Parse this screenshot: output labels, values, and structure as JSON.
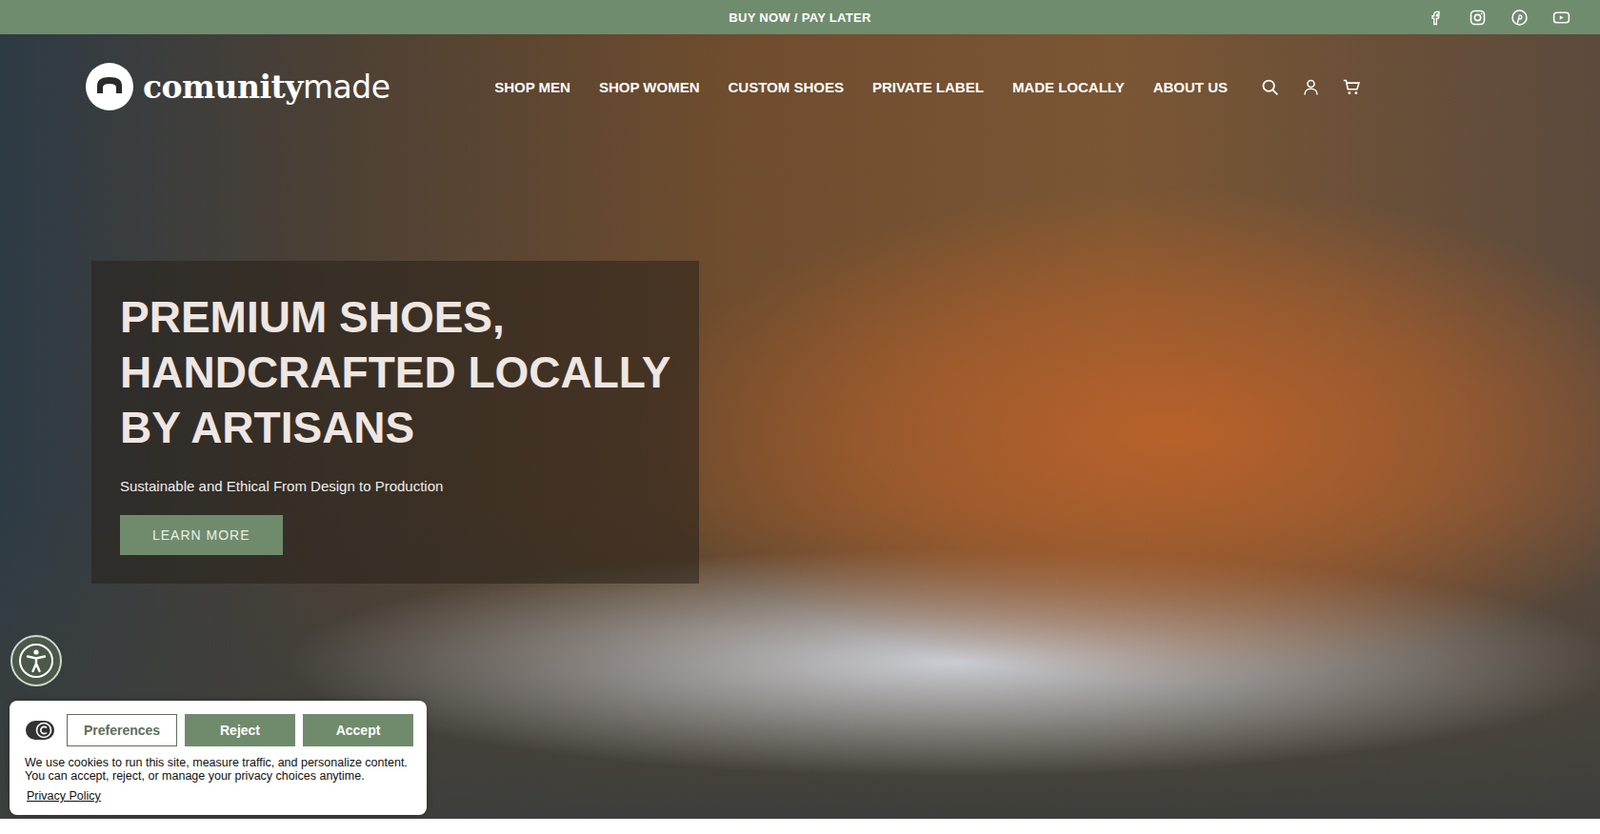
{
  "announcement": "BUY NOW / PAY LATER",
  "social": [
    "facebook",
    "instagram",
    "pinterest",
    "youtube"
  ],
  "logo": {
    "bold": "comunity",
    "light": "made"
  },
  "nav": [
    "SHOP MEN",
    "SHOP WOMEN",
    "CUSTOM SHOES",
    "PRIVATE LABEL",
    "MADE LOCALLY",
    "ABOUT US"
  ],
  "hero": {
    "title_lines": [
      "PREMIUM SHOES,",
      "HANDCRAFTED LOCALLY",
      "BY ARTISANS"
    ],
    "subtitle": "Sustainable and Ethical From Design to Production",
    "button": "LEARN MORE"
  },
  "cookie": {
    "buttons": [
      "Preferences",
      "Reject",
      "Accept"
    ],
    "text": "We use cookies to run this site, measure traffic, and personalize content. You can accept, reject, or manage your privacy choices anytime.",
    "link": "Privacy Policy"
  }
}
